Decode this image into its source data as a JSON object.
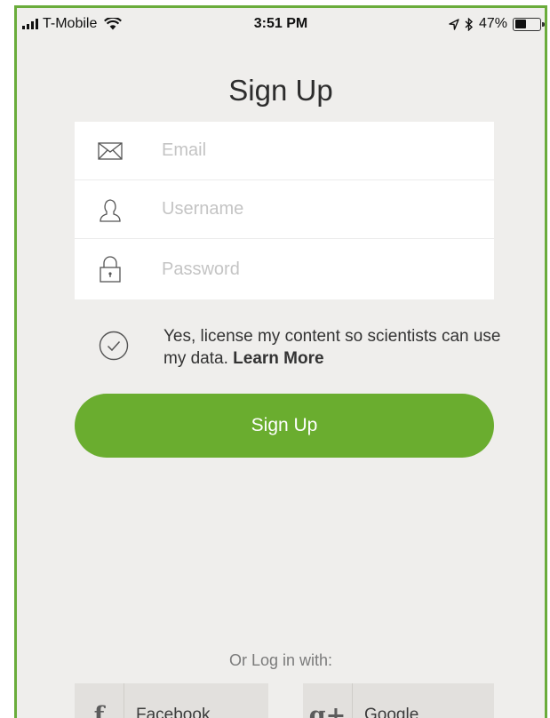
{
  "status_bar": {
    "carrier": "T-Mobile",
    "time": "3:51 PM",
    "battery": "47%",
    "battery_level": 0.47,
    "icons": [
      "signal-icon",
      "wifi-icon",
      "location-icon",
      "bluetooth-icon",
      "battery-icon"
    ]
  },
  "title": "Sign Up",
  "form": {
    "email": {
      "placeholder": "Email",
      "value": "",
      "icon": "envelope-icon"
    },
    "username": {
      "placeholder": "Username",
      "value": "",
      "icon": "user-icon"
    },
    "password": {
      "placeholder": "Password",
      "value": "",
      "icon": "lock-icon"
    }
  },
  "consent": {
    "text": "Yes, license my content so scientists can use my data.",
    "learn_more": "Learn More",
    "checked": true
  },
  "signup_button": "Sign Up",
  "or_login_label": "Or Log in with:",
  "social": {
    "facebook": {
      "label": "Facebook",
      "icon_glyph": "f"
    },
    "google": {
      "label": "Google",
      "icon_glyph": "g+"
    }
  },
  "colors": {
    "accent_green": "#6aad2f",
    "background": "#efeeec"
  }
}
